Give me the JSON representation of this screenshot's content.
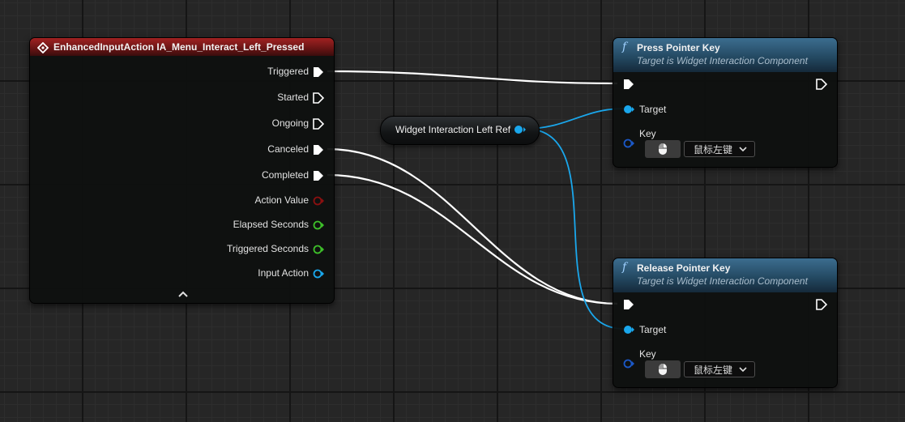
{
  "event_node": {
    "title": "EnhancedInputAction IA_Menu_Interact_Left_Pressed",
    "icon": "event-diamond-icon",
    "outputs": [
      {
        "label": "Triggered",
        "type": "exec"
      },
      {
        "label": "Started",
        "type": "exec"
      },
      {
        "label": "Ongoing",
        "type": "exec"
      },
      {
        "label": "Canceled",
        "type": "exec"
      },
      {
        "label": "Completed",
        "type": "exec"
      },
      {
        "label": "Action Value",
        "type": "data"
      },
      {
        "label": "Elapsed Seconds",
        "type": "data"
      },
      {
        "label": "Triggered Seconds",
        "type": "data"
      },
      {
        "label": "Input Action",
        "type": "data"
      }
    ],
    "collapse_icon": "chevron-up-icon"
  },
  "variable_node": {
    "label": "Widget Interaction Left Ref"
  },
  "press_node": {
    "title": "Press Pointer Key",
    "subtitle": "Target is Widget Interaction Component",
    "target_label": "Target",
    "key_label": "Key",
    "key_value": "鼠标左键"
  },
  "release_node": {
    "title": "Release Pointer Key",
    "subtitle": "Target is Widget Interaction Component",
    "target_label": "Target",
    "key_label": "Key",
    "key_value": "鼠标左键"
  },
  "colors": {
    "exec_wire": "#ffffff",
    "object_pin": "#1aa7ec",
    "action_value_pin": "#8a1010",
    "float_pin": "#3ec02a",
    "input_action_pin": "#1aa7ec",
    "key_pin": "#1b58c7",
    "event_header": "#a12222",
    "function_header": "#3c6d8f"
  }
}
